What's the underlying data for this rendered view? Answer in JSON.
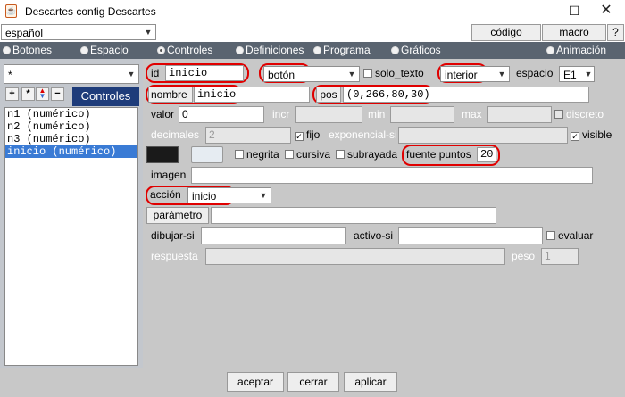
{
  "window": {
    "title": "Descartes config Descartes",
    "icon": "java-icon"
  },
  "top": {
    "language": "español",
    "codigo_label": "código",
    "macro_label": "macro",
    "help_label": "?"
  },
  "tabs": [
    {
      "label": "Botones",
      "selected": false
    },
    {
      "label": "Espacio",
      "selected": false
    },
    {
      "label": "Controles",
      "selected": true
    },
    {
      "label": "Definiciones",
      "selected": false
    },
    {
      "label": "Programa",
      "selected": false
    },
    {
      "label": "Gráficos",
      "selected": false
    },
    {
      "label": "Animación",
      "selected": false
    }
  ],
  "left": {
    "filter": "*",
    "controles_label": "Controles",
    "items": [
      "n1 (numérico)",
      "n2 (numérico)",
      "n3 (numérico)",
      "inicio (numérico)"
    ],
    "selected_index": 3
  },
  "form": {
    "id_label": "id",
    "id_value": "inicio",
    "type_value": "botón",
    "solo_texto_label": "solo_texto",
    "region_value": "interior",
    "espacio_label": "espacio",
    "espacio_value": "E1",
    "nombre_label": "nombre",
    "nombre_value": "inicio",
    "pos_label": "pos",
    "pos_value": "(0,266,80,30)",
    "valor_label": "valor",
    "valor_value": "0",
    "incr_label": "incr",
    "min_label": "min",
    "max_label": "max",
    "discreto_label": "discreto",
    "decimales_label": "decimales",
    "decimales_value": "2",
    "fijo_label": "fijo",
    "exponencial_label": "exponencial-si",
    "visible_label": "visible",
    "negrita_label": "negrita",
    "cursiva_label": "cursiva",
    "subrayada_label": "subrayada",
    "fuente_label": "fuente puntos",
    "fuente_value": "20",
    "imagen_label": "imagen",
    "accion_label": "acción",
    "accion_value": "inicio",
    "parametro_label": "parámetro",
    "dibujar_label": "dibujar-si",
    "activo_label": "activo-si",
    "evaluar_label": "evaluar",
    "respuesta_label": "respuesta",
    "peso_label": "peso",
    "peso_value": "1",
    "colors": {
      "color_dark": "#1a1a1a",
      "color_light": "#e6ecf2",
      "highlight": "#e00000"
    }
  },
  "footer": {
    "aceptar": "aceptar",
    "cerrar": "cerrar",
    "aplicar": "aplicar"
  }
}
